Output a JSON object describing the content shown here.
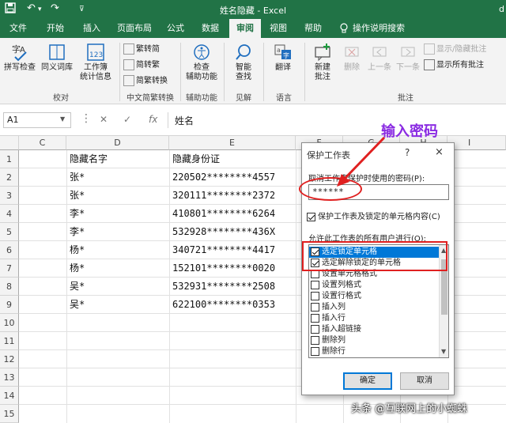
{
  "titlebar": {
    "document_title": "姓名隐藏 - Excel",
    "trailing_text": "d"
  },
  "menu": {
    "tabs": [
      "文件",
      "开始",
      "插入",
      "页面布局",
      "公式",
      "数据",
      "审阅",
      "视图",
      "帮助",
      "操作说明搜索"
    ],
    "active_tab": "审阅"
  },
  "ribbon": {
    "proofing": {
      "spell_check": "拼写检查",
      "thesaurus": "同义词库",
      "workbook_stats_line1": "工作簿",
      "workbook_stats_line2": "统计信息",
      "group_label": "校对"
    },
    "chinese_conversion": {
      "to_traditional": "繁转简",
      "to_simplified": "简转繁",
      "conversion": "简繁转换",
      "group_label": "中文简繁转换"
    },
    "accessibility": {
      "check_line1": "检查",
      "check_line2": "辅助功能",
      "group_label": "辅助功能"
    },
    "insights": {
      "smart_line1": "智能",
      "smart_line2": "查找",
      "group_label": "见解"
    },
    "language": {
      "translate": "翻译",
      "group_label": "语言"
    },
    "comments": {
      "new_line1": "新建",
      "new_line2": "批注",
      "delete": "删除",
      "previous": "上一条",
      "next": "下一条",
      "show_hide": "显示/隐藏批注",
      "show_all": "显示所有批注",
      "group_label": "批注"
    }
  },
  "formula_bar": {
    "name_box": "A1",
    "cancel_symbol": "✕",
    "enter_symbol": "✓",
    "fx_symbol": "fx",
    "content": "姓名"
  },
  "sheet": {
    "columns": [
      "C",
      "D",
      "E",
      "F",
      "G",
      "H",
      "I"
    ],
    "rows": [
      "1",
      "2",
      "3",
      "4",
      "5",
      "6",
      "7",
      "8",
      "9",
      "10",
      "11",
      "12",
      "13",
      "14",
      "15"
    ],
    "header_name": "隐藏名字",
    "header_id": "隐藏身份证",
    "data": [
      {
        "name": "张*",
        "id": "220502********4557"
      },
      {
        "name": "张*",
        "id": "320111********2372"
      },
      {
        "name": "李*",
        "id": "410801********6264"
      },
      {
        "name": "李*",
        "id": "532928********436X"
      },
      {
        "name": "杨*",
        "id": "340721********4417"
      },
      {
        "name": "杨*",
        "id": "152101********0020"
      },
      {
        "name": "吴*",
        "id": "532931********2508"
      },
      {
        "name": "吴*",
        "id": "622100********0353"
      }
    ]
  },
  "dialog": {
    "title": "保护工作表",
    "help": "?",
    "close": "×",
    "password_label": "取消工作表保护时使用的密码(P):",
    "password_value": "******",
    "protect_label": "保护工作表及锁定的单元格内容(C)",
    "protect_checked": true,
    "allow_label": "允许此工作表的所有用户进行(O):",
    "permissions": [
      {
        "label": "选定锁定单元格",
        "checked": true
      },
      {
        "label": "选定解除锁定的单元格",
        "checked": true
      },
      {
        "label": "设置单元格格式",
        "checked": false
      },
      {
        "label": "设置列格式",
        "checked": false
      },
      {
        "label": "设置行格式",
        "checked": false
      },
      {
        "label": "插入列",
        "checked": false
      },
      {
        "label": "插入行",
        "checked": false
      },
      {
        "label": "插入超链接",
        "checked": false
      },
      {
        "label": "删除列",
        "checked": false
      },
      {
        "label": "删除行",
        "checked": false
      }
    ],
    "ok": "确定",
    "cancel": "取消"
  },
  "annotation": {
    "text": "输入密码",
    "color": "#8a2be2",
    "highlight_color": "#e02020"
  },
  "watermark": "头条 @互联网上的小蜘蛛",
  "colors": {
    "excel_green": "#217346",
    "selection_blue": "#0078d7"
  }
}
